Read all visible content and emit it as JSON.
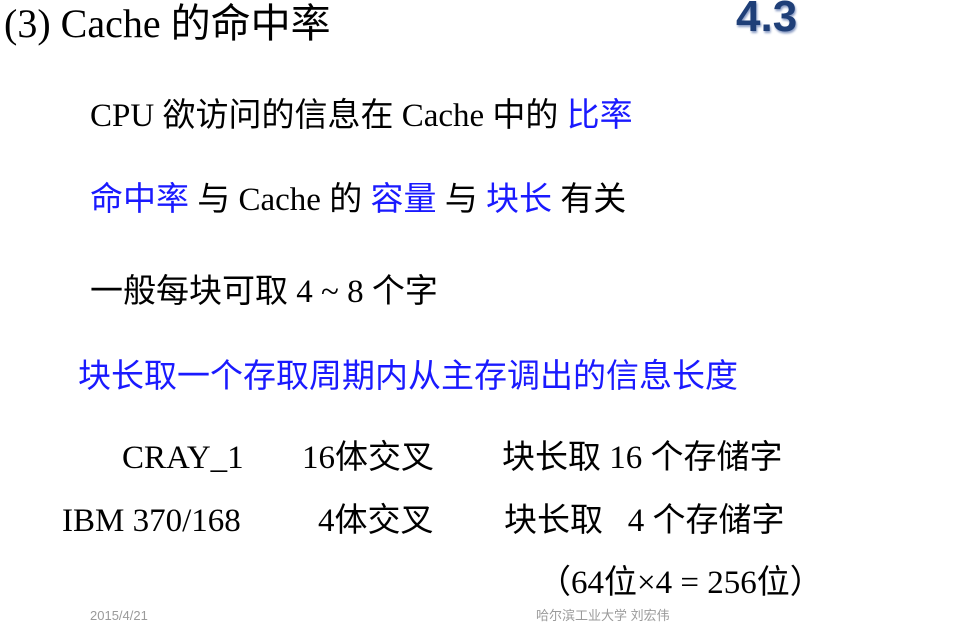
{
  "colors": {
    "accent": "#1a1aff",
    "badge": "#1f3f78",
    "footer": "#9a9a9a"
  },
  "title": "(3) Cache 的命中率",
  "section_number": "4.3",
  "line1": {
    "prefix": "CPU 欲访问的信息在 Cache 中的 ",
    "highlight": "比率"
  },
  "line2": {
    "hl1": "命中率",
    "t1": " 与 Cache 的 ",
    "hl2": "容量",
    "t2": " 与 ",
    "hl3": "块长",
    "t3": " 有关"
  },
  "line3": "一般每块可取 4 ~ 8 个字",
  "line4": "块长取一个存取周期内从主存调出的信息长度",
  "examples": [
    {
      "machine": "CRAY_1",
      "interleave": "16体交叉",
      "block": "块长取 16 个存储字"
    },
    {
      "machine": "IBM 370/168",
      "interleave": "4体交叉",
      "block": "块长取   4 个存储字"
    }
  ],
  "note": "（64位×4 = 256位）",
  "footer": {
    "date": "2015/4/21",
    "author": "哈尔滨工业大学 刘宏伟"
  }
}
